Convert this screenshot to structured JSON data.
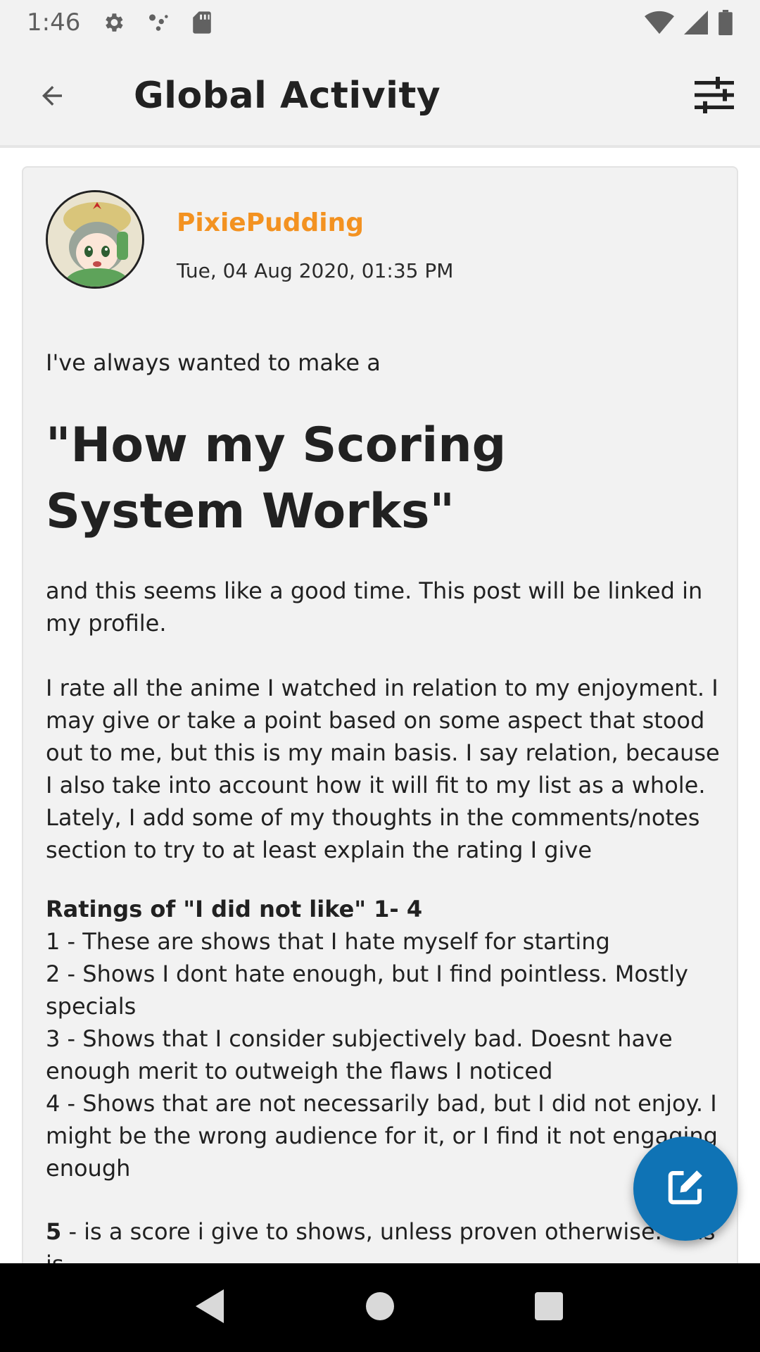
{
  "status_bar": {
    "time": "1:46",
    "icons": [
      "gear-icon",
      "network-dots-icon",
      "sd-card-icon",
      "wifi-icon",
      "cellular-signal-icon",
      "battery-icon"
    ]
  },
  "app_bar": {
    "title": "Global Activity",
    "back_icon": "arrow-back-icon",
    "filter_icon": "sliders-icon"
  },
  "post": {
    "username": "PixiePudding",
    "timestamp": "Tue, 04 Aug 2020, 01:35 PM",
    "intro": "I've always wanted to make a",
    "heading": "\"How my Scoring System Works\"",
    "para1": "and this seems like a good time. This post will be linked in my profile.",
    "para2": "I rate all the anime I watched in relation to my enjoyment. I may give or take a point based on some aspect that stood out to me, but this is my main basis. I say relation, because I also take into account how it will fit to my list as a whole. Lately, I add some of my thoughts in the comments/notes section to try to at least explain the rating I give",
    "ratings_heading": "Ratings of \"I did not like\" 1- 4",
    "rating_1": "1 - These are shows that I hate myself for starting",
    "rating_2": "2 - Shows I dont hate enough, but I find pointless. Mostly specials",
    "rating_3": "3 - Shows that I consider subjectively bad. Doesnt have enough merit to outweigh the flaws I noticed",
    "rating_4": "4 - Shows that are not necessarily bad, but I did not enjoy. I might be the wrong audience for it, or I find it not engaging enough",
    "rating_5_num": "5",
    "rating_5_text": " - is a score i give to shows, unless proven otherwise. This is"
  },
  "fab": {
    "icon": "compose-icon"
  },
  "nav_bar": {
    "back": "nav-back-icon",
    "home": "nav-home-icon",
    "recents": "nav-recents-icon"
  },
  "colors": {
    "accent": "#0f73b5",
    "username": "#f39221",
    "surface": "#f2f2f2"
  }
}
